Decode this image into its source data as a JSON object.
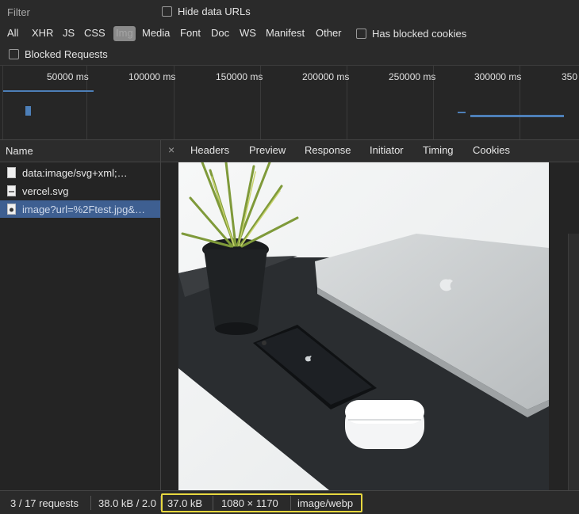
{
  "toolbar": {
    "filter_placeholder": "Filter",
    "hide_data_urls": "Hide data URLs",
    "types": [
      "All",
      "XHR",
      "JS",
      "CSS",
      "Img",
      "Media",
      "Font",
      "Doc",
      "WS",
      "Manifest",
      "Other"
    ],
    "active_type": "Img",
    "has_blocked_cookies": "Has blocked cookies",
    "blocked_requests": "Blocked Requests"
  },
  "timeline": {
    "ticks": [
      "50000 ms",
      "100000 ms",
      "150000 ms",
      "200000 ms",
      "250000 ms",
      "300000 ms",
      "350"
    ]
  },
  "list": {
    "header": "Name",
    "rows": [
      {
        "label": "data:image/svg+xml;…",
        "icon": "file-icon"
      },
      {
        "label": "vercel.svg",
        "icon": "svg-file-icon"
      },
      {
        "label": "image?url=%2Ftest.jpg&…",
        "icon": "image-file-icon"
      }
    ],
    "selected_index": 2
  },
  "detail": {
    "close": "×",
    "tabs": [
      "Headers",
      "Preview",
      "Response",
      "Initiator",
      "Timing",
      "Cookies"
    ],
    "active_tab": "Preview"
  },
  "status": {
    "requests": "3 / 17 requests",
    "transferred": "38.0 kB / 2.0",
    "size": "37.0 kB",
    "dimensions": "1080 × 1170",
    "mime": "image/webp",
    "highlight_color": "#e8d840"
  }
}
